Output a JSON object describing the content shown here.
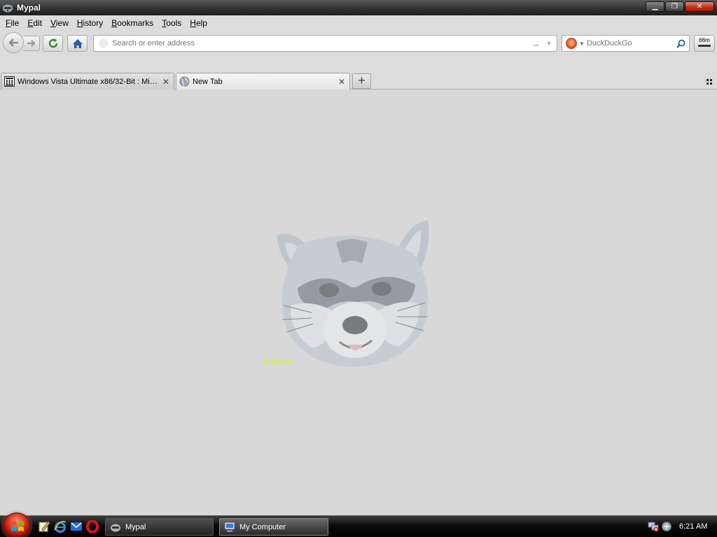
{
  "window": {
    "title": "Mypal"
  },
  "window_controls": {
    "minimize": "▁",
    "maximize": "❐",
    "close": "✕"
  },
  "menu": {
    "items": [
      {
        "label": "File"
      },
      {
        "label": "Edit"
      },
      {
        "label": "View"
      },
      {
        "label": "History"
      },
      {
        "label": "Bookmarks"
      },
      {
        "label": "Tools"
      },
      {
        "label": "Help"
      }
    ]
  },
  "navbar": {
    "address": {
      "value": "",
      "placeholder": "Search or enter address"
    },
    "search": {
      "engine": "DuckDuckGo",
      "placeholder": "DuckDuckGo"
    },
    "speed_badge": "66m"
  },
  "tabs": [
    {
      "label": "Windows Vista Ultimate x86/32-Bit : Micr...",
      "favicon": "archive-icon",
      "active": false
    },
    {
      "label": "New Tab",
      "favicon": "globe-icon",
      "active": true
    }
  ],
  "taskbar": {
    "buttons": [
      {
        "label": "Mypal",
        "icon": "mypal-icon"
      },
      {
        "label": "My Computer",
        "icon": "computer-icon"
      }
    ],
    "clock": "6:21 AM"
  },
  "colors": {
    "title_bar": "#2e2e2e",
    "content_bg": "#d8d8d8",
    "close_button": "#c03018",
    "start_orb": "#d42a10"
  }
}
